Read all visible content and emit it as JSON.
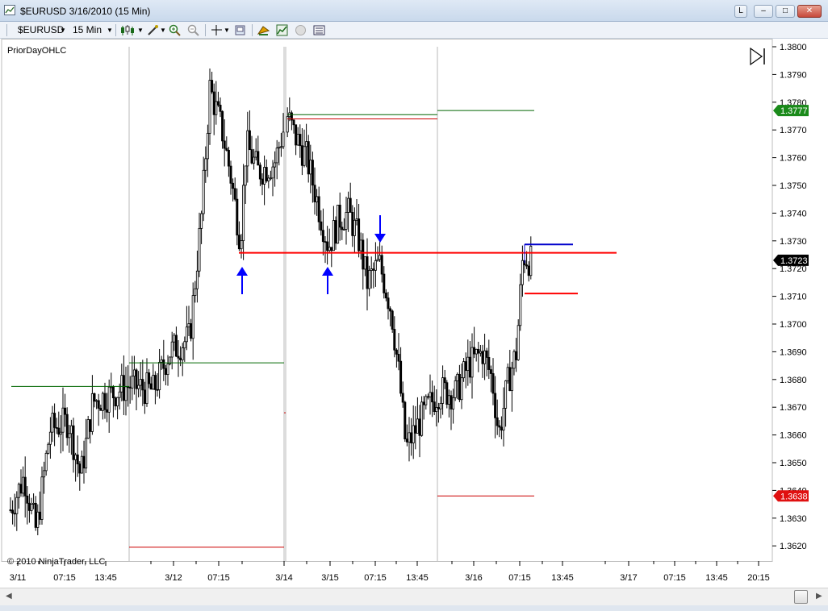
{
  "window": {
    "title": "$EURUSD  3/16/2010 (15 Min)",
    "buttons": [
      "L",
      "–",
      "□",
      "✕"
    ]
  },
  "toolbar": {
    "instrument": "$EURUSD",
    "interval": "15 Min"
  },
  "chart": {
    "indicator_label": "PriorDayOHLC",
    "copyright": "© 2010 NinjaTrader, LLC",
    "y_ticks": [
      "1.3800",
      "1.3790",
      "1.3780",
      "1.3770",
      "1.3760",
      "1.3750",
      "1.3740",
      "1.3730",
      "1.3720",
      "1.3710",
      "1.3700",
      "1.3690",
      "1.3680",
      "1.3670",
      "1.3660",
      "1.3650",
      "1.3640",
      "1.3630",
      "1.3620"
    ],
    "x_ticks": [
      "3/11",
      "07:15",
      "13:45",
      "3/12",
      "07:15",
      "3/14",
      "3/15",
      "07:15",
      "13:45",
      "3/16",
      "07:15",
      "13:45",
      "3/17",
      "07:15",
      "13:45",
      "20:15"
    ],
    "price_labels": [
      {
        "value": "1.3777",
        "color": "#1a8a1a"
      },
      {
        "value": "1.3723",
        "color": "#000000"
      },
      {
        "value": "1.3638",
        "color": "#e01010"
      }
    ],
    "colors": {
      "support": "#ff0000",
      "high": "#006600",
      "low": "#cc0000",
      "arrow": "#0000ff"
    }
  }
}
